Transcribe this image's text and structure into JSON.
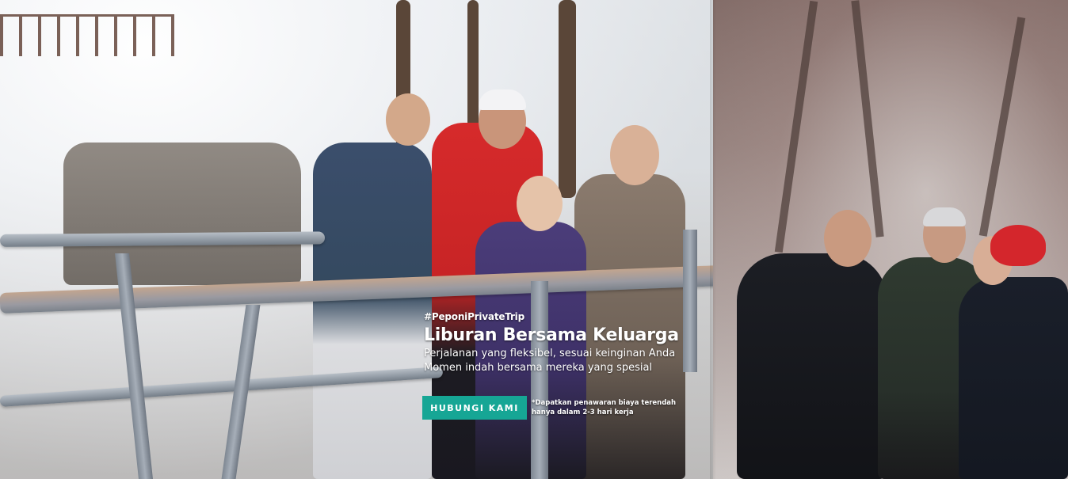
{
  "promo": {
    "hashtag": "#PeponiPrivateTrip",
    "headline": "Liburan Bersama Keluarga",
    "subline_1": "Perjalanan yang fleksibel, sesuai keinginan Anda",
    "subline_2": "Momen indah bersama mereka yang spesial",
    "cta_label": "HUBUNGI KAMI",
    "disclaimer_1": "*Dapatkan penawaran biaya terendah",
    "disclaimer_2": "hanya dalam 2-3 hari kerja"
  },
  "colors": {
    "cta_background": "#16a695",
    "text": "#ffffff"
  }
}
